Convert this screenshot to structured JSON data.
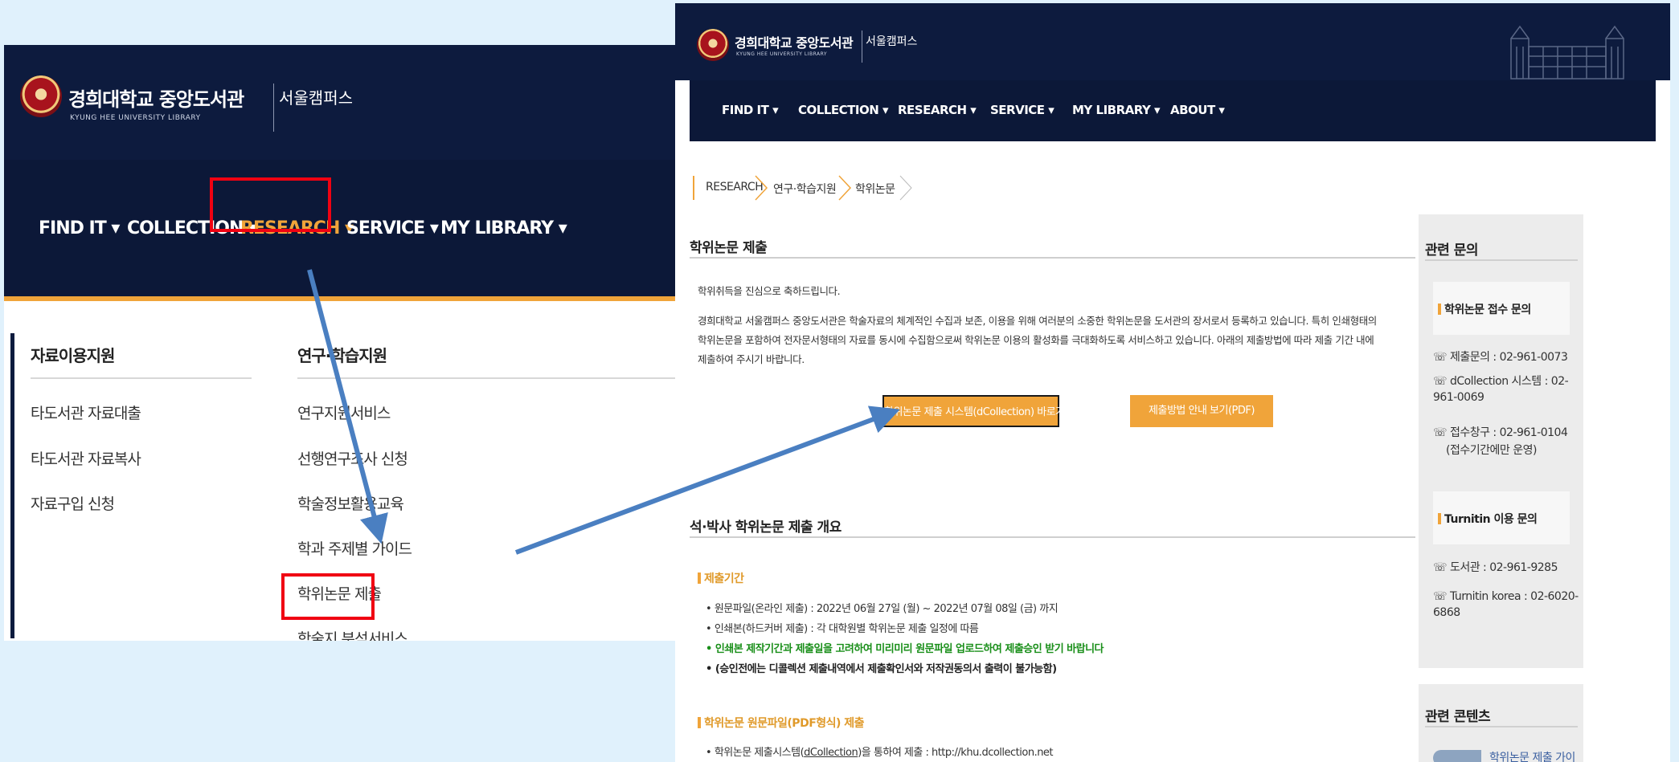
{
  "left": {
    "logo": {
      "title": "경희대학교 중앙도서관",
      "sub": "KYUNG HEE UNIVERSITY LIBRARY",
      "campus": "서울캠퍼스"
    },
    "nav": [
      {
        "label": "FIND IT ▾"
      },
      {
        "label": "COLLECTION ▾"
      },
      {
        "label": "RESEARCH ▾"
      },
      {
        "label": "SERVICE ▾"
      },
      {
        "label": "MY LIBRARY ▾"
      }
    ],
    "menu": {
      "col1": {
        "heading": "자료이용지원",
        "items": [
          "타도서관 자료대출",
          "타도서관 자료복사",
          "자료구입 신청"
        ]
      },
      "col2": {
        "heading": "연구·학습지원",
        "items": [
          "연구지원서비스",
          "선행연구조사 신청",
          "학술정보활용교육",
          "학과 주제별 가이드",
          "학위논문 제출",
          "학술지 분석서비스"
        ]
      }
    }
  },
  "right": {
    "logo": {
      "title": "경희대학교 중앙도서관",
      "sub": "KYUNG HEE UNIVERSITY LIBRARY",
      "campus": "서울캠퍼스"
    },
    "nav": [
      "FIND IT ▾",
      "COLLECTION ▾",
      "RESEARCH ▾",
      "SERVICE ▾",
      "MY LIBRARY ▾",
      "ABOUT ▾"
    ],
    "breadcrumb": [
      "RESEARCH",
      "연구·학습지원",
      "학위논문"
    ],
    "section1": {
      "title": "학위논문 제출",
      "greeting": "학위취득을 진심으로 축하드립니다.",
      "body": "경희대학교 서울캠퍼스 중앙도서관은 학술자료의 체계적인 수집과 보존, 이용을 위해 여러분의 소중한 학위논문을 도서관의 장서로서 등록하고 있습니다. 특히 인쇄형태의 학위논문을 포함하여 전자문서형태의 자료를 동시에 수집함으로써 학위논문 이용의 활성화를 극대화하도록 서비스하고 있습니다. 아래의 제출방법에 따라 제출 기간 내에 제출하여 주시기 바랍니다.",
      "btn_system": "학위논문 제출 시스템(dCollection) 바로가기",
      "btn_guide": "제출방법 안내 보기(PDF)"
    },
    "section2": {
      "title": "석·박사 학위논문 제출 개요",
      "period_head": "제출기간",
      "bullets": [
        "원문파일(온라인 제출) : 2022년 06월 27일 (월) ~ 2022년 07월 08일 (금) 까지",
        "인쇄본(하드커버 제출) : 각 대학원별 학위논문 제출 일정에 따름",
        "인쇄본 제작기간과 제출일을 고려하여 미리미리 원문파일 업로드하여 제출승인 받기 바랍니다",
        "(승인전에는 디콜렉션 제출내역에서 제출확인서와 저작권동의서 출력이 불가능함)"
      ],
      "pdf_head": "학위논문 원문파일(PDF형식) 제출",
      "pdf_bullet_prefix": "학위논문 제출시스템(",
      "pdf_bullet_link": "dCollection",
      "pdf_bullet_suffix": ")을 통하여 제출 : http://khu.dcollection.net"
    },
    "sidebar": {
      "inquiry_title": "관련 문의",
      "thesis_head": "학위논문 접수 문의",
      "thesis_lines": [
        "☏ 제출문의 : 02-961-0073",
        "☏ dCollection 시스템 : 02-961-0069",
        "☏ 접수창구 : 02-961-0104",
        "(접수기간에만 운영)"
      ],
      "turnitin_head": "Turnitin 이용 문의",
      "turnitin_lines": [
        "☏ 도서관 : 02-961-9285",
        "☏ Turnitin korea : 02-6020-6868"
      ],
      "content_title": "관련 콘텐츠",
      "content_item": "학위논문 제출 가이"
    }
  },
  "colors": {
    "bg": "#e0f1fc",
    "navy": "#0d1b3e",
    "accent": "#f0a43a",
    "highlight": "#f00212",
    "arrow": "#4a7fc1",
    "green": "#1a8f1a"
  }
}
